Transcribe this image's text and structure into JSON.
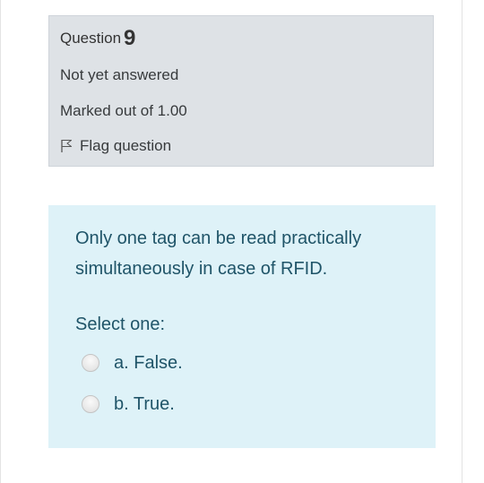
{
  "question_info": {
    "heading_label": "Question",
    "number": "9",
    "state": "Not yet answered",
    "grade": "Marked out of 1.00",
    "flag_label": "Flag question",
    "flag_icon": "flag-outline-icon"
  },
  "question": {
    "text": "Only one tag can be read practically simultaneously in case of RFID.",
    "prompt": "Select one:",
    "options": [
      {
        "label": "a. False.",
        "selected": false
      },
      {
        "label": "b. True.",
        "selected": false
      }
    ]
  },
  "colors": {
    "info_background": "#dee2e6",
    "content_background": "#def2f8",
    "question_text": "#1f5468"
  }
}
